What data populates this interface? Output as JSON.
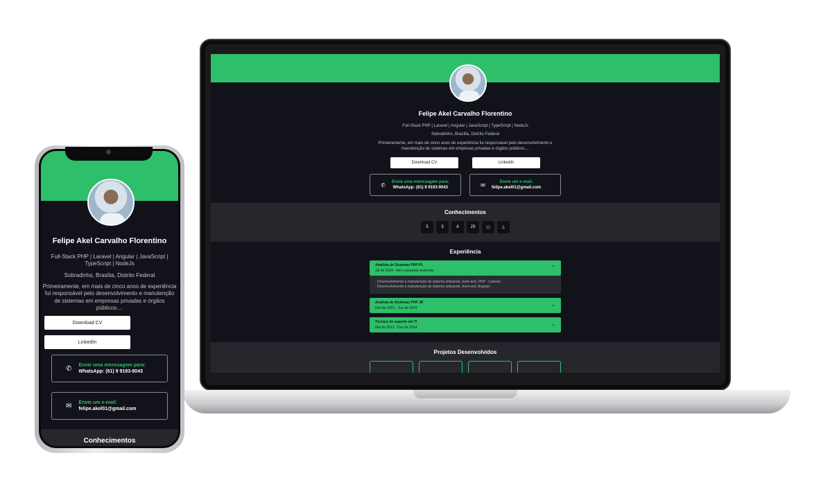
{
  "profile": {
    "name": "Felipe Akel Carvalho Florentino",
    "stack": "Full-Stack PHP | Laravel | Angular | JavaScript | TypeScript | NodeJs",
    "stack_mobile_1": "Full-Stack PHP | Laravel | Angular | JavaScript |",
    "stack_mobile_2": "TypeScript | NodeJs",
    "location": "Sobradinho, Brasília, Distrito Federal",
    "bio_1": "Primeiramente, em mais de cinco anos de experiência fui responsável pelo desenvolvimento e",
    "bio_2": "manutenção de sistemas em empresas privadas e órgãos públicos....",
    "bio_m1": "Primeiramente, em mais de cinco anos de experiência",
    "bio_m2": "fui responsável pelo desenvolvimento e manutenção",
    "bio_m3": "de sistemas em empresas privadas e órgãos",
    "bio_m4": "públicos...."
  },
  "buttons": {
    "download_cv": "Download CV",
    "linkedin": "LinkedIn"
  },
  "contacts": {
    "whatsapp_title": "Envie uma menssagem para:",
    "whatsapp_value": "WhatsApp: (61) 9 9193-9043",
    "email_title": "Envie um e-mail:",
    "email_value": "felipe.akel01@gmail.com"
  },
  "sections": {
    "skills": "Conhecimentos",
    "experience": "Experiência",
    "projects": "Projetos Desenvolvidos"
  },
  "skills": [
    "html5-icon",
    "css3-icon",
    "angular-icon",
    "javascript-icon",
    "nodejs-icon",
    "laravel-icon"
  ],
  "experience": [
    {
      "role": "Analista de Sistemas PHP PL",
      "period": "Jul de 2024 - Até o presente momento",
      "details": [
        "- Desenvolvimento e manutenção de sistema utilizando, back-end, PHP - Laravel;",
        "- Desenvolvimento e manutenção de sistema utilizando, front-end, Angular;"
      ]
    },
    {
      "role": "Analista de Sistemas PHP JR",
      "period": "Dez de 2021 - Jun de 2024"
    },
    {
      "role": "Técnico de suporte em TI",
      "period": "Mai de 2013 - Dez de 2014"
    }
  ],
  "colors": {
    "accent": "#2ebf6a",
    "background": "#11121a",
    "section_alt": "#26272d"
  }
}
